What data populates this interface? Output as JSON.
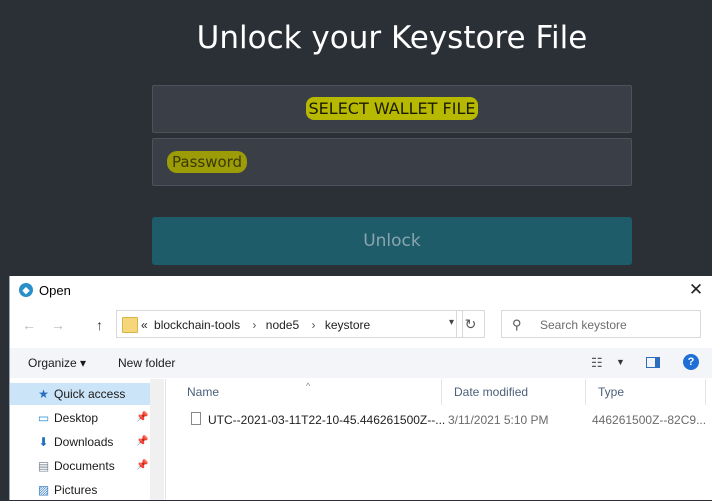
{
  "app": {
    "title": "Unlock your Keystore File",
    "select_file_label": "SELECT WALLET FILE",
    "password_placeholder": "Password",
    "unlock_label": "Unlock"
  },
  "dialog": {
    "title": "Open",
    "close_glyph": "✕",
    "nav": {
      "back": "←",
      "forward": "→",
      "up": "↑"
    },
    "address": {
      "prefix": "«",
      "crumbs": [
        "blockchain-tools",
        "node5",
        "keystore"
      ],
      "separator": "›"
    },
    "refresh_glyph": "↻",
    "search_placeholder": "Search keystore",
    "toolbar": {
      "organize": "Organize ▾",
      "new_folder": "New folder",
      "view_glyph": "☷",
      "view_drop": "▼",
      "help": "?"
    },
    "nav_pane": [
      {
        "label": "Quick access",
        "icon": "★",
        "selected": true,
        "pinned": false
      },
      {
        "label": "Desktop",
        "icon": "▭",
        "selected": false,
        "pinned": true
      },
      {
        "label": "Downloads",
        "icon": "⬇",
        "selected": false,
        "pinned": true
      },
      {
        "label": "Documents",
        "icon": "▤",
        "selected": false,
        "pinned": true
      },
      {
        "label": "Pictures",
        "icon": "▨",
        "selected": false,
        "pinned": false
      }
    ],
    "columns": {
      "name": "Name",
      "date": "Date modified",
      "type": "Type"
    },
    "files": [
      {
        "name": "UTC--2021-03-11T22-10-45.446261500Z--...",
        "date": "3/11/2021 5:10 PM",
        "type": "446261500Z--82C9..."
      }
    ]
  },
  "colors": {
    "app_bg": "#2b2f36",
    "highlight": "#b7b800",
    "unlock_button": "#1f5c6a",
    "selection": "#cce4f7"
  }
}
